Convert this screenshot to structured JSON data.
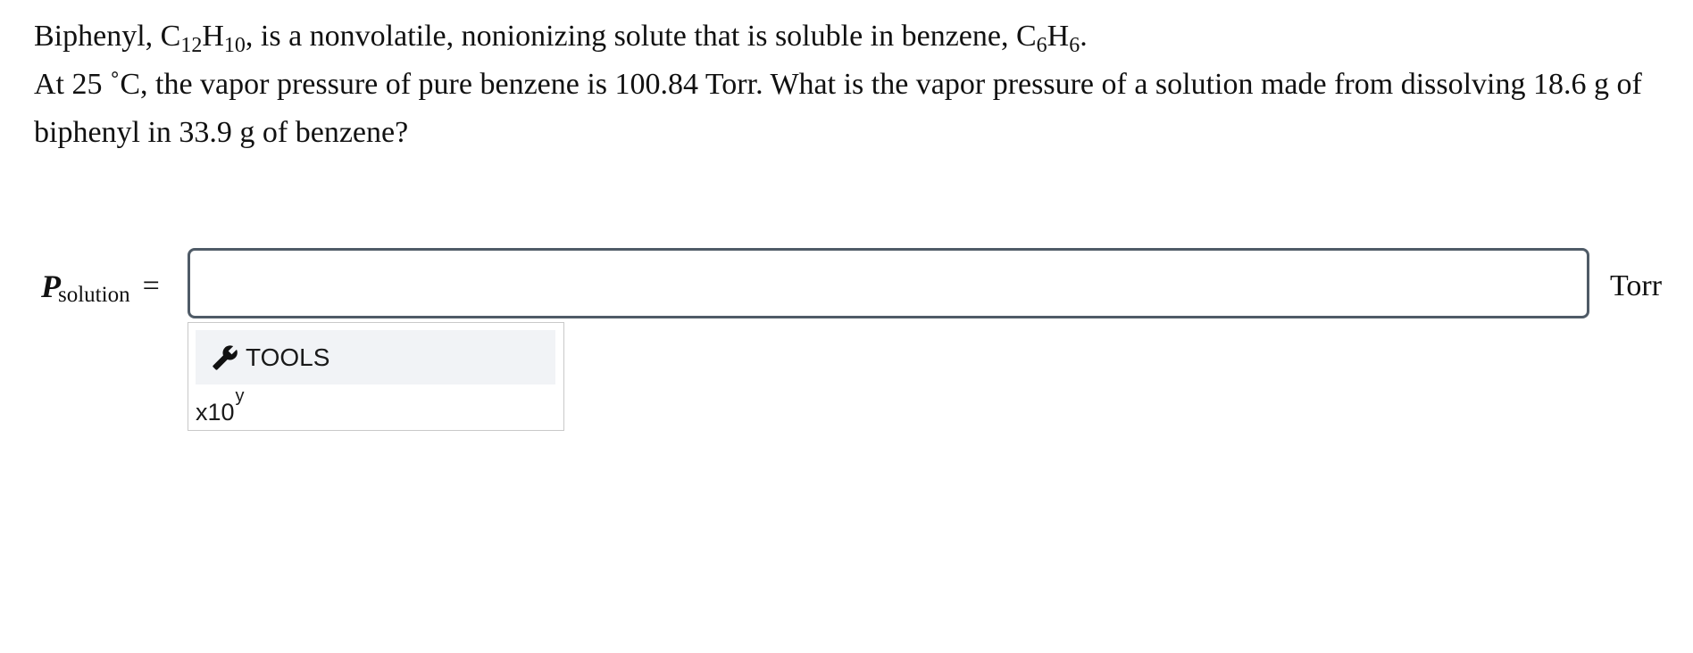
{
  "question": {
    "line1": {
      "pre": "Biphenyl, C",
      "sub1": "12",
      "mid1": "H",
      "sub2": "10",
      "mid2": ", is a nonvolatile, nonionizing solute that is soluble in benzene, C",
      "sub3": "6",
      "mid3": "H",
      "sub4": "6",
      "post": "."
    },
    "line2": "At 25 ˚C, the vapor pressure of pure benzene is 100.84 Torr. What is the vapor pressure of a solution made from dissolving 18.6 g of biphenyl in 33.9 g of benzene?"
  },
  "answer": {
    "variable": "P",
    "variable_subscript": "solution",
    "equals": "=",
    "input_value": "",
    "input_placeholder": "",
    "unit": "Torr"
  },
  "tools": {
    "icon": "wrench-icon",
    "button_label": "TOOLS",
    "sci_base": "x10",
    "sci_exponent": "y"
  }
}
